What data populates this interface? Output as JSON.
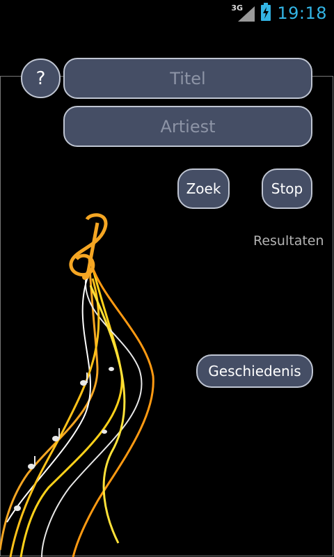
{
  "status_bar": {
    "network": "3G",
    "time": "19:18"
  },
  "help_button": {
    "label": "?"
  },
  "fields": {
    "title": {
      "placeholder": "Titel",
      "value": ""
    },
    "artist": {
      "placeholder": "Artiest",
      "value": ""
    }
  },
  "buttons": {
    "search": "Zoek",
    "stop": "Stop",
    "history": "Geschiedenis"
  },
  "results_label": "Resultaten",
  "colors": {
    "accent": "#33b5e5",
    "button_bg": "#454e65",
    "button_border": "#bfc5d2"
  }
}
